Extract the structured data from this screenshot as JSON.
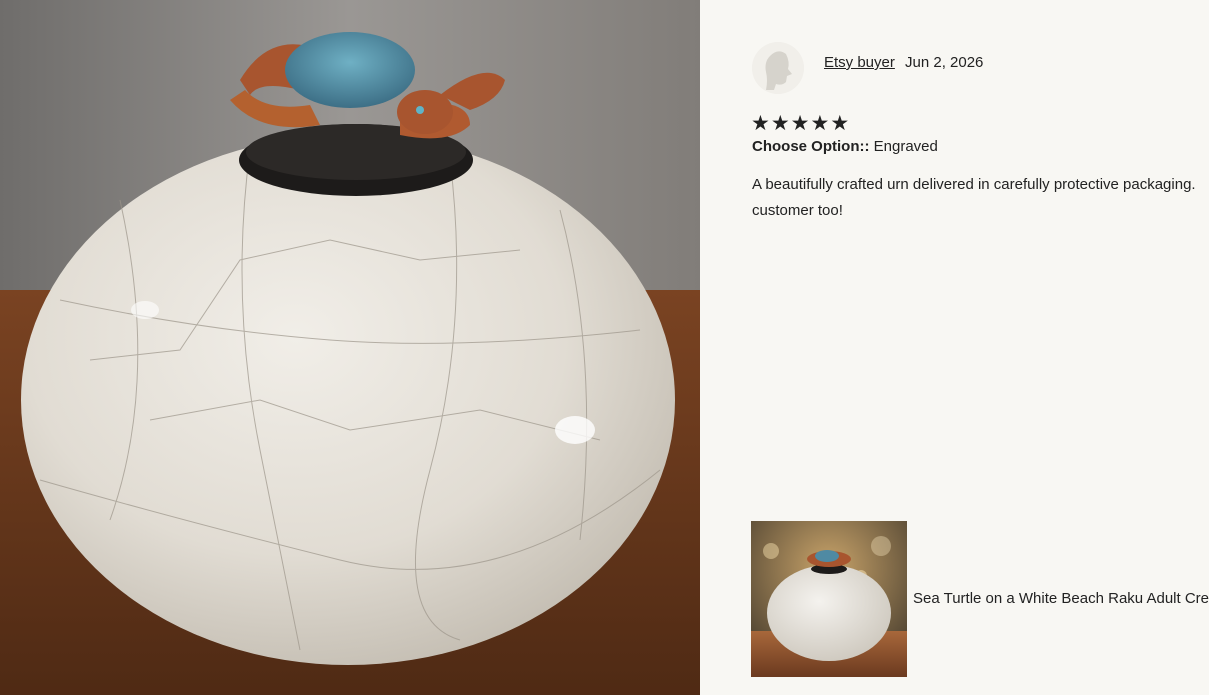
{
  "review": {
    "reviewer_name": "Etsy buyer",
    "date": "Jun 2, 2026",
    "rating": 5,
    "stars": [
      "★",
      "★",
      "★",
      "★",
      "★"
    ],
    "option_label": "Choose Option::",
    "option_value": "Engraved",
    "text_line_1": "A beautifully crafted urn delivered in carefully protective packaging.",
    "text_line_2": "customer too!"
  },
  "product": {
    "title": "Sea Turtle on a White Beach Raku Adult Cre"
  },
  "icons": {
    "avatar": "default-user-silhouette-icon",
    "star": "star-icon"
  },
  "colors": {
    "page_background": "#f8f7f3",
    "text": "#222222",
    "urn_glaze": "#e3ded6",
    "table_wood": "#6b3a1f",
    "turtle_copper": "#a8552f",
    "turtle_shell_blue": "#4f8aa3"
  }
}
